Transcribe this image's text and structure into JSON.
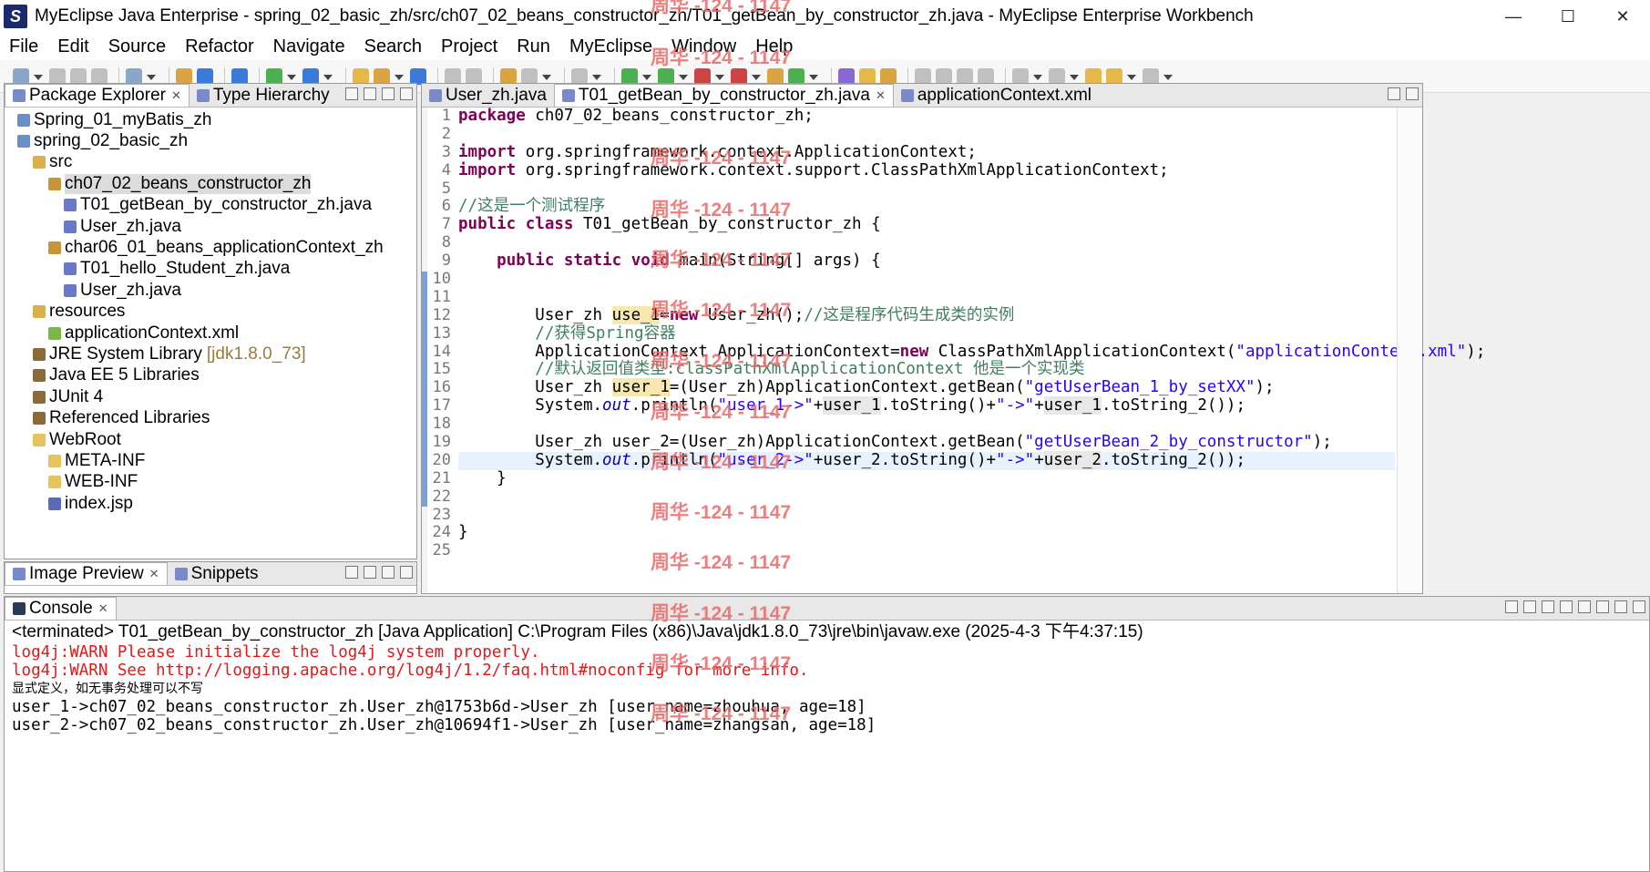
{
  "window": {
    "title": "MyEclipse Java Enterprise - spring_02_basic_zh/src/ch07_02_beans_constructor_zh/T01_getBean_by_constructor_zh.java - MyEclipse Enterprise Workbench",
    "minimize": "—",
    "maximize": "☐",
    "close": "✕"
  },
  "menu": [
    "File",
    "Edit",
    "Source",
    "Refactor",
    "Navigate",
    "Search",
    "Project",
    "Run",
    "MyEclipse",
    "Window",
    "Help"
  ],
  "explorer": {
    "tabs": [
      {
        "label": "Package Explorer",
        "active": true,
        "close": "✕"
      },
      {
        "label": "Type Hierarchy",
        "active": false
      }
    ],
    "tree": [
      {
        "label": "Spring_01_myBatis_zh",
        "indent": 0,
        "icon": "project-icon"
      },
      {
        "label": "spring_02_basic_zh",
        "indent": 0,
        "icon": "project-icon"
      },
      {
        "label": "src",
        "indent": 1,
        "icon": "source-folder-icon"
      },
      {
        "label": "ch07_02_beans_constructor_zh",
        "indent": 2,
        "icon": "package-icon",
        "selected": true
      },
      {
        "label": "T01_getBean_by_constructor_zh.java",
        "indent": 3,
        "icon": "java-file-icon"
      },
      {
        "label": "User_zh.java",
        "indent": 3,
        "icon": "java-file-icon"
      },
      {
        "label": "char06_01_beans_applicationContext_zh",
        "indent": 2,
        "icon": "package-icon"
      },
      {
        "label": "T01_hello_Student_zh.java",
        "indent": 3,
        "icon": "java-file-icon"
      },
      {
        "label": "User_zh.java",
        "indent": 3,
        "icon": "java-file-icon"
      },
      {
        "label": "resources",
        "indent": 1,
        "icon": "source-folder-icon"
      },
      {
        "label": "applicationContext.xml",
        "indent": 2,
        "icon": "xml-file-icon"
      },
      {
        "label": "JRE System Library",
        "extra": "[jdk1.8.0_73]",
        "indent": 1,
        "icon": "library-icon"
      },
      {
        "label": "Java EE 5 Libraries",
        "indent": 1,
        "icon": "library-icon"
      },
      {
        "label": "JUnit 4",
        "indent": 1,
        "icon": "library-icon"
      },
      {
        "label": "Referenced Libraries",
        "indent": 1,
        "icon": "library-icon"
      },
      {
        "label": "WebRoot",
        "indent": 1,
        "icon": "folder-icon"
      },
      {
        "label": "META-INF",
        "indent": 2,
        "icon": "folder-icon"
      },
      {
        "label": "WEB-INF",
        "indent": 2,
        "icon": "folder-icon"
      },
      {
        "label": "index.jsp",
        "indent": 2,
        "icon": "jsp-file-icon"
      }
    ]
  },
  "bottom_left": {
    "tabs": [
      {
        "label": "Image Preview",
        "active": true,
        "close": "✕"
      },
      {
        "label": "Snippets",
        "active": false
      }
    ]
  },
  "editor": {
    "tabs": [
      {
        "label": "User_zh.java",
        "active": false
      },
      {
        "label": "T01_getBean_by_constructor_zh.java",
        "active": true,
        "close": "✕"
      },
      {
        "label": "applicationContext.xml",
        "active": false
      }
    ],
    "current_line": 20,
    "lines": [
      [
        {
          "t": "package",
          "c": "kw"
        },
        {
          "t": " ch07_02_beans_constructor_zh;"
        }
      ],
      [],
      [
        {
          "t": "import",
          "c": "kw"
        },
        {
          "t": " org.springframework.context.ApplicationContext;"
        }
      ],
      [
        {
          "t": "import",
          "c": "kw"
        },
        {
          "t": " org.springframework.context.support.ClassPathXmlApplicationContext;"
        }
      ],
      [],
      [
        {
          "t": "//这是一个测试程序",
          "c": "cm"
        }
      ],
      [
        {
          "t": "public",
          "c": "kw"
        },
        {
          "t": " "
        },
        {
          "t": "class",
          "c": "kw"
        },
        {
          "t": " T01_getBean_by_constructor_zh {"
        }
      ],
      [],
      [
        {
          "t": "    "
        },
        {
          "t": "public",
          "c": "kw"
        },
        {
          "t": " "
        },
        {
          "t": "static",
          "c": "kw"
        },
        {
          "t": " "
        },
        {
          "t": "void",
          "c": "kw"
        },
        {
          "t": " main(String[] args) {"
        }
      ],
      [],
      [],
      [
        {
          "t": "        User_zh "
        },
        {
          "t": "use_1",
          "c": "hl2"
        },
        {
          "t": "="
        },
        {
          "t": "new",
          "c": "kw"
        },
        {
          "t": " User_zh();"
        },
        {
          "t": "//这是程序代码生成类的实例",
          "c": "cm"
        }
      ],
      [
        {
          "t": "        "
        },
        {
          "t": "//获得Spring容器",
          "c": "cm"
        }
      ],
      [
        {
          "t": "        ApplicationContext ApplicationContext="
        },
        {
          "t": "new",
          "c": "kw"
        },
        {
          "t": " ClassPathXmlApplicationContext("
        },
        {
          "t": "\"applicationContext.xml\"",
          "c": "str"
        },
        {
          "t": ");"
        }
      ],
      [
        {
          "t": "        "
        },
        {
          "t": "//默认返回值类型:classPathXmlApplicationContext 他是一个实现类",
          "c": "cm"
        }
      ],
      [
        {
          "t": "        User_zh "
        },
        {
          "t": "user_1",
          "c": "hl2"
        },
        {
          "t": "=(User_zh)ApplicationContext.getBean("
        },
        {
          "t": "\"getUserBean_1_by_setXX\"",
          "c": "str"
        },
        {
          "t": ");"
        }
      ],
      [
        {
          "t": "        System."
        },
        {
          "t": "out",
          "c": "it"
        },
        {
          "t": ".println("
        },
        {
          "t": "\"user_1->\"",
          "c": "str"
        },
        {
          "t": "+"
        },
        {
          "t": "user_1",
          "c": "hl"
        },
        {
          "t": ".toString()+"
        },
        {
          "t": "\"->\"",
          "c": "str"
        },
        {
          "t": "+"
        },
        {
          "t": "user_1",
          "c": "hl"
        },
        {
          "t": ".toString_2());"
        }
      ],
      [],
      [
        {
          "t": "        User_zh user_2=(User_zh)ApplicationContext.getBean("
        },
        {
          "t": "\"getUserBean_2_by_constructor\"",
          "c": "str"
        },
        {
          "t": ");"
        }
      ],
      [
        {
          "t": "        System."
        },
        {
          "t": "out",
          "c": "it"
        },
        {
          "t": ".println("
        },
        {
          "t": "\"user_2->\"",
          "c": "str"
        },
        {
          "t": "+user_2.toString()+"
        },
        {
          "t": "\"->\"",
          "c": "str"
        },
        {
          "t": "+"
        },
        {
          "t": "user_2",
          "c": "hl"
        },
        {
          "t": ".toString_2());"
        }
      ],
      [
        {
          "t": "    }"
        }
      ],
      [],
      [],
      [
        {
          "t": "}"
        }
      ],
      []
    ]
  },
  "console": {
    "tab": {
      "label": "Console",
      "close": "✕"
    },
    "header": "<terminated> T01_getBean_by_constructor_zh [Java Application] C:\\Program Files (x86)\\Java\\jdk1.8.0_73\\jre\\bin\\javaw.exe (2025-4-3 下午4:37:15)",
    "lines": [
      {
        "text": "log4j:WARN Please initialize the log4j system properly.",
        "kind": "err"
      },
      {
        "text": "log4j:WARN See http://logging.apache.org/log4j/1.2/faq.html#noconfig for more info.",
        "kind": "err"
      },
      {
        "text": "显式定义，如无事务处理可以不写",
        "kind": "cn"
      },
      {
        "text": "user_1->ch07_02_beans_constructor_zh.User_zh@1753b6d->User_zh [user_name=zhouhua, age=18]",
        "kind": "out"
      },
      {
        "text": "user_2->ch07_02_beans_constructor_zh.User_zh@10694f1->User_zh [user_name=zhangsan, age=18]",
        "kind": "out"
      }
    ]
  },
  "watermark": "周华 -124 - 1147"
}
